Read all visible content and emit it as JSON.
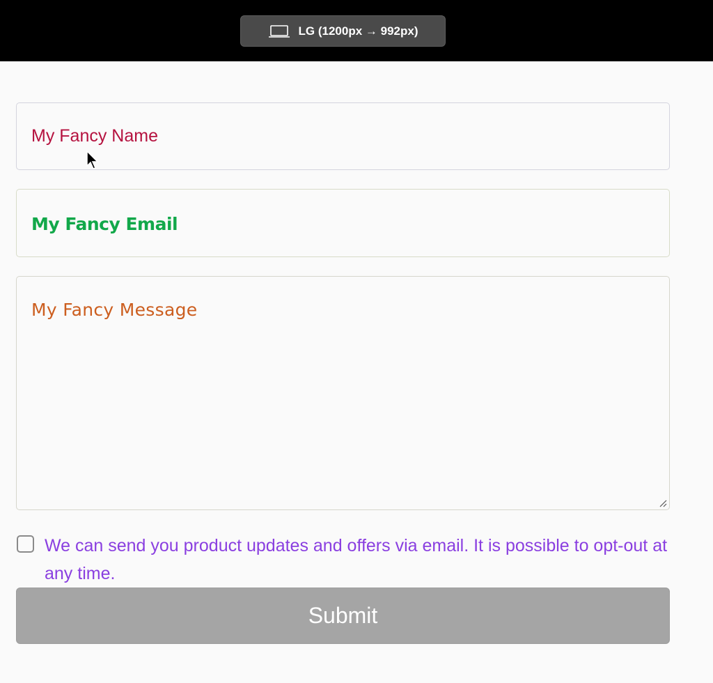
{
  "topbar": {
    "viewport_icon": "laptop-icon",
    "viewport_label": "LG (1200px → 992px)"
  },
  "form": {
    "name_value": "My Fancy Name",
    "email_value": "My Fancy Email",
    "message_value": "My Fancy Message",
    "consent_label": "We can send you product updates and offers via email. It is possible to opt-out at any time.",
    "consent_checked": false,
    "submit_label": "Submit"
  },
  "colors": {
    "name": "#b5123f",
    "email": "#12a84a",
    "message": "#cc5e1f",
    "consent": "#8a3fe0",
    "submit_bg": "#a5a5a5"
  }
}
